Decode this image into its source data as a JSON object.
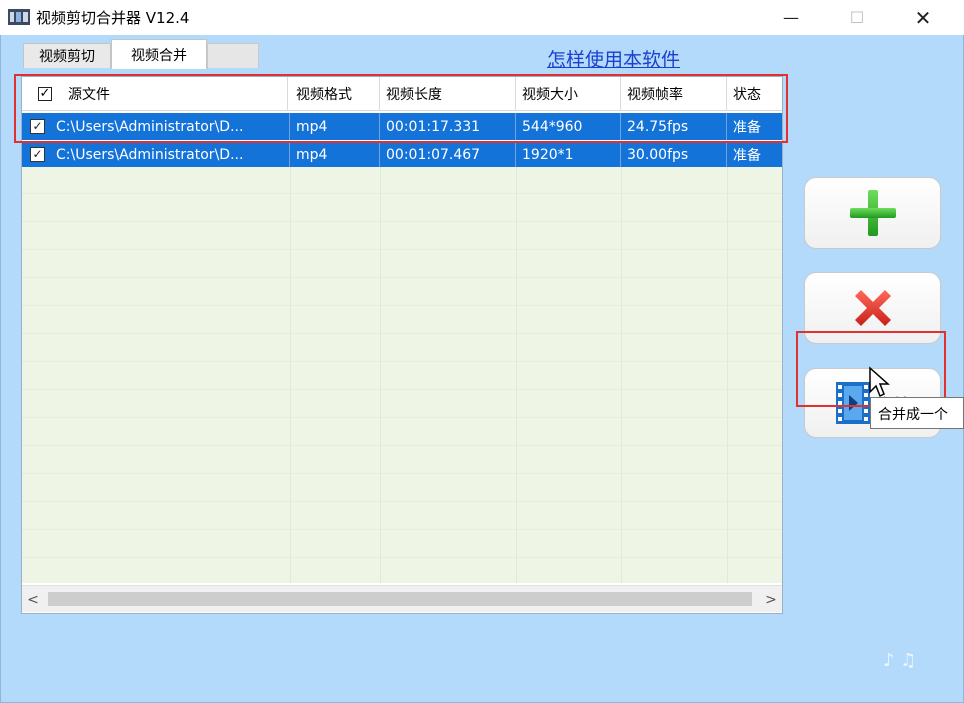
{
  "window": {
    "title": "视频剪切合并器 V12.4",
    "minimize": "—",
    "maximize": "☐",
    "close": "✕"
  },
  "tabs": [
    {
      "label": "视频剪切",
      "active": false
    },
    {
      "label": "视频合并",
      "active": true
    }
  ],
  "help_link": "怎样使用本软件",
  "table": {
    "headers": [
      "源文件",
      "视频格式",
      "视频长度",
      "视频大小",
      "视频帧率",
      "状态"
    ],
    "header_checked": true,
    "rows": [
      {
        "checked": true,
        "file": "C:\\Users\\Administrator\\D...",
        "format": "mp4",
        "length": "00:01:17.331",
        "size": "544*960",
        "fps": "24.75fps",
        "status": "准备"
      },
      {
        "checked": true,
        "file": "C:\\Users\\Administrator\\D...",
        "format": "mp4",
        "length": "00:01:07.467",
        "size": "1920*1",
        "fps": "30.00fps",
        "status": "准备"
      }
    ]
  },
  "scrollbar": {
    "left_arrow": "<",
    "right_arrow": ">"
  },
  "buttons": {
    "add_icon": "plus-icon",
    "delete_icon": "x-icon",
    "merge_label": "合并",
    "merge_icon": "film-play-icon"
  },
  "tooltip": "合并成一个",
  "colors": {
    "client_bg": "#b3dafb",
    "row_selected": "#1473d9",
    "highlight": "#e03030",
    "add_green": "#2fb52f",
    "delete_red": "#e0322d"
  }
}
